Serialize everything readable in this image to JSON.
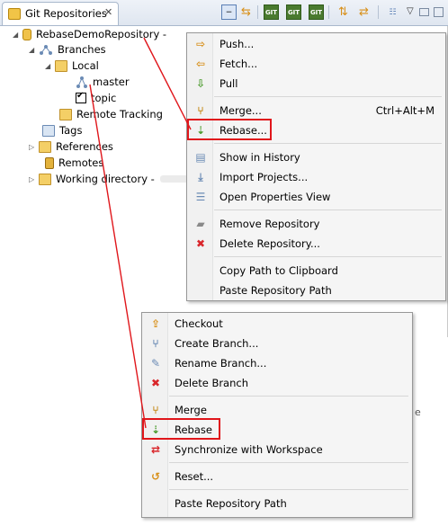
{
  "view": {
    "tab_title": "Git Repositories",
    "close_glyph": "✕",
    "toolbar_git_label": "GIT"
  },
  "tree": {
    "repository": "RebaseDemoRepository -",
    "branches": "Branches",
    "local": "Local",
    "master": "master",
    "topic": "topic",
    "remote_tracking": "Remote Tracking",
    "tags": "Tags",
    "references": "References",
    "remotes": "Remotes",
    "working_directory": "Working directory -"
  },
  "repo_menu": {
    "items": [
      {
        "label": "Push...",
        "icon": "push-icon",
        "color": "#d8901a"
      },
      {
        "label": "Fetch...",
        "icon": "fetch-icon",
        "color": "#d8901a"
      },
      {
        "label": "Pull",
        "icon": "pull-icon",
        "color": "#4a9a2c"
      },
      {
        "label": "Merge...",
        "icon": "merge-icon",
        "color": "#c58a1a",
        "accelerator": "Ctrl+Alt+M"
      },
      {
        "label": "Rebase...",
        "icon": "rebase-icon",
        "color": "#4a9a2c"
      },
      {
        "label": "Show in History",
        "icon": "history-icon",
        "color": "#6b8bb5"
      },
      {
        "label": "Import Projects...",
        "icon": "import-icon",
        "color": "#6b8bb5"
      },
      {
        "label": "Open Properties View",
        "icon": "properties-icon",
        "color": "#6b8bb5"
      },
      {
        "label": "Remove Repository",
        "icon": "eraser-icon",
        "color": "#8a8a8a"
      },
      {
        "label": "Delete Repository...",
        "icon": "delete-icon",
        "color": "#d9262b"
      },
      {
        "label": "Copy Path to Clipboard"
      },
      {
        "label": "Paste Repository Path"
      }
    ]
  },
  "branch_menu": {
    "items": [
      {
        "label": "Checkout",
        "icon": "checkout-icon"
      },
      {
        "label": "Create Branch...",
        "icon": "create-branch-icon"
      },
      {
        "label": "Rename Branch...",
        "icon": "rename-icon"
      },
      {
        "label": "Delete Branch",
        "icon": "delete-icon"
      },
      {
        "label": "Merge",
        "icon": "merge-icon"
      },
      {
        "label": "Rebase",
        "icon": "rebase-icon"
      },
      {
        "label": "Synchronize with Workspace",
        "icon": "synchronize-icon"
      },
      {
        "label": "Reset...",
        "icon": "reset-icon"
      },
      {
        "label": "Paste Repository Path"
      }
    ]
  },
  "annotation": {
    "color": "#e0161b"
  },
  "background_text": "e"
}
